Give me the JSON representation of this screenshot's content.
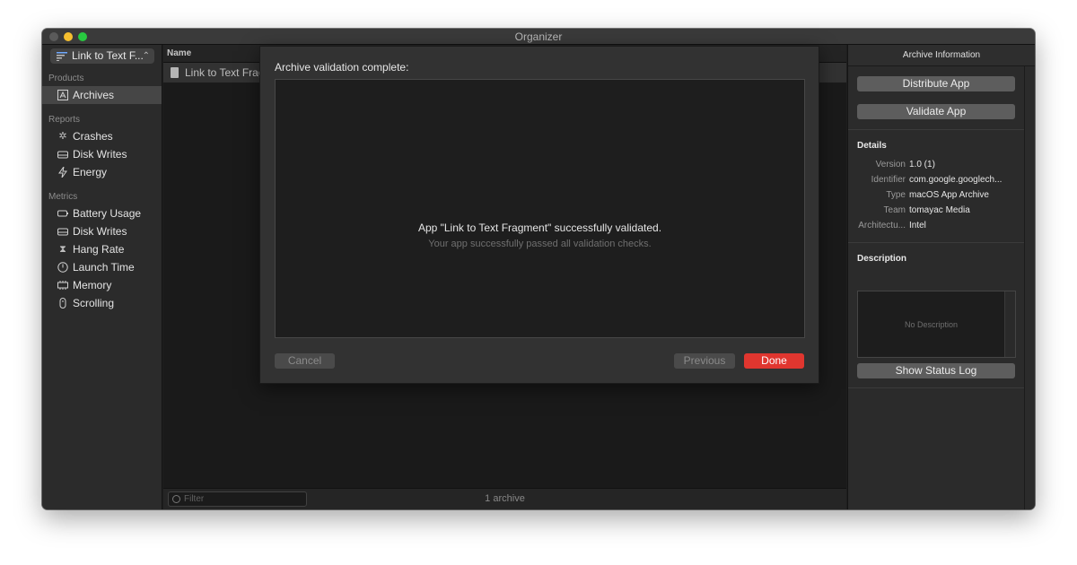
{
  "window": {
    "title": "Organizer"
  },
  "sidebar": {
    "scheme_label": "Link to Text F...",
    "sections": {
      "products": "Products",
      "reports": "Reports",
      "metrics": "Metrics"
    },
    "products_items": [
      {
        "label": "Archives",
        "icon": "archive-icon",
        "selected": true
      }
    ],
    "reports_items": [
      {
        "label": "Crashes",
        "icon": "crash-icon"
      },
      {
        "label": "Disk Writes",
        "icon": "disk-icon"
      },
      {
        "label": "Energy",
        "icon": "bolt-icon"
      }
    ],
    "metrics_items": [
      {
        "label": "Battery Usage",
        "icon": "battery-icon"
      },
      {
        "label": "Disk Writes",
        "icon": "disk-icon"
      },
      {
        "label": "Hang Rate",
        "icon": "hourglass-icon"
      },
      {
        "label": "Launch Time",
        "icon": "clock-icon"
      },
      {
        "label": "Memory",
        "icon": "memory-icon"
      },
      {
        "label": "Scrolling",
        "icon": "scroll-icon"
      }
    ]
  },
  "list": {
    "column_name": "Name",
    "rows": [
      {
        "name": "Link to Text Frag"
      }
    ],
    "filter_placeholder": "Filter",
    "count_label": "1 archive"
  },
  "inspector": {
    "title": "Archive Information",
    "distribute_label": "Distribute App",
    "validate_label": "Validate App",
    "details_heading": "Details",
    "details": [
      {
        "key": "Version",
        "value": "1.0 (1)"
      },
      {
        "key": "Identifier",
        "value": "com.google.googlech..."
      },
      {
        "key": "Type",
        "value": "macOS App Archive"
      },
      {
        "key": "Team",
        "value": "tomayac Media"
      },
      {
        "key": "Architectu...",
        "value": "Intel"
      }
    ],
    "description_heading": "Description",
    "description_placeholder": "No Description",
    "status_log_label": "Show Status Log"
  },
  "sheet": {
    "title": "Archive validation complete:",
    "message": "App \"Link to Text Fragment\" successfully validated.",
    "submessage": "Your app successfully passed all validation checks.",
    "cancel_label": "Cancel",
    "previous_label": "Previous",
    "done_label": "Done"
  },
  "colors": {
    "accent_done": "#e0362f",
    "background": "#1e1e1e",
    "sidebar": "#2b2b2b"
  }
}
